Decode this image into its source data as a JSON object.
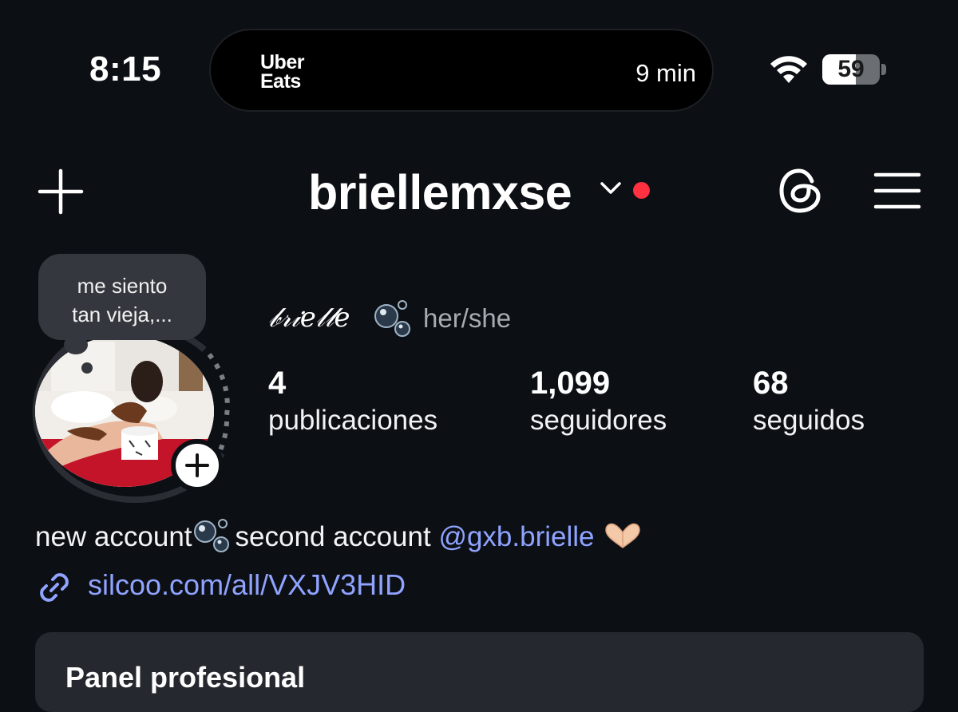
{
  "status_bar": {
    "time": "8:15",
    "live_activity": {
      "brand": "Uber\nEats",
      "eta": "9 min"
    },
    "wifi_icon": "wifi-icon",
    "battery": {
      "percent": 59,
      "label": "59"
    }
  },
  "header": {
    "username": "briellemxse",
    "has_notification_dot": true,
    "notification_color": "#ff3040"
  },
  "note": {
    "text": "me siento\ntan vieja,..."
  },
  "profile": {
    "display_name": "𝒷𝓇𝒾𝑒𝓁𝓁𝑒",
    "pronouns": "her/she"
  },
  "stats": [
    {
      "value": "4",
      "label": "publicaciones"
    },
    {
      "value": "1,099",
      "label": "seguidores"
    },
    {
      "value": "68",
      "label": "seguidos"
    }
  ],
  "bio": {
    "part1": "new account",
    "part2": "second account ",
    "mention": "@gxb.brielle"
  },
  "link": {
    "text": "silcoo.com/all/VXJV3HID"
  },
  "panel": {
    "title": "Panel profesional"
  },
  "colors": {
    "background": "#0c0f14",
    "accent_link": "#8fa3ff",
    "panel": "#25282e"
  }
}
